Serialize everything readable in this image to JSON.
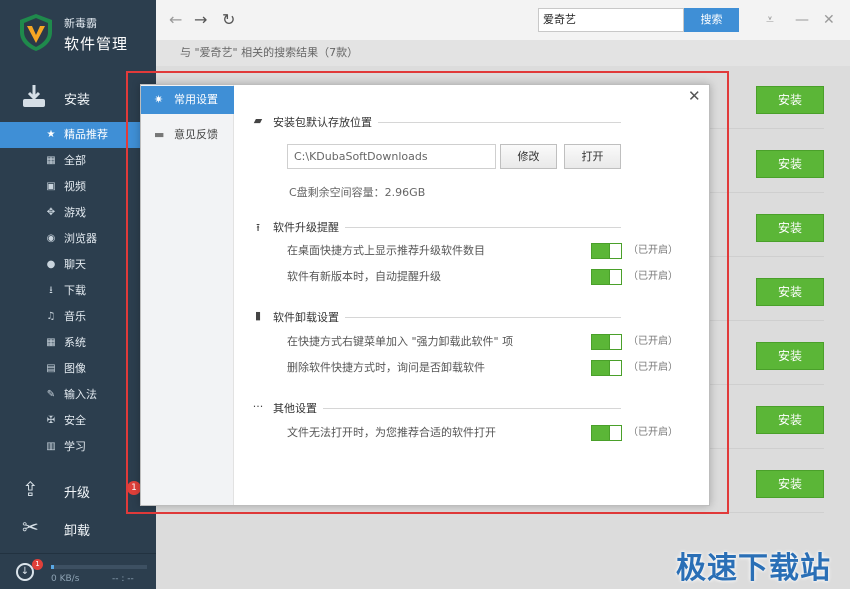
{
  "app": {
    "brand_small": "新毒霸",
    "brand_big": "软件管理"
  },
  "sidebar": {
    "install_label": "安装",
    "items": [
      {
        "label": "精品推荐",
        "icon": "star-icon",
        "glyph": "★",
        "active": true
      },
      {
        "label": "全部",
        "icon": "grid-icon",
        "glyph": "▦"
      },
      {
        "label": "视频",
        "icon": "video-icon",
        "glyph": "▣"
      },
      {
        "label": "游戏",
        "icon": "gamepad-icon",
        "glyph": "✥"
      },
      {
        "label": "浏览器",
        "icon": "globe-icon",
        "glyph": "◉"
      },
      {
        "label": "聊天",
        "icon": "chat-icon",
        "glyph": "●"
      },
      {
        "label": "下载",
        "icon": "download-icon",
        "glyph": "⭳"
      },
      {
        "label": "音乐",
        "icon": "music-icon",
        "glyph": "♫"
      },
      {
        "label": "系统",
        "icon": "windows-icon",
        "glyph": "▦"
      },
      {
        "label": "图像",
        "icon": "image-icon",
        "glyph": "▤"
      },
      {
        "label": "输入法",
        "icon": "pen-icon",
        "glyph": "✎"
      },
      {
        "label": "安全",
        "icon": "shield-icon",
        "glyph": "✠"
      },
      {
        "label": "学习",
        "icon": "book-icon",
        "glyph": "▥"
      }
    ],
    "upgrade_label": "升级",
    "upgrade_badge": "1",
    "uninstall_label": "卸载",
    "download_badge": "1",
    "download_speed": "0 KB/s",
    "download_eta": "-- : --",
    "download_progress": 0.03
  },
  "topbar": {
    "search_value": "爱奇艺",
    "search_button": "搜索"
  },
  "results": {
    "summary": "与 \"爱奇艺\" 相关的搜索结果（7款）",
    "install_label": "安装",
    "count": 7
  },
  "dialog": {
    "tabs": [
      {
        "label": "常用设置",
        "icon": "gear-icon",
        "glyph": "✷",
        "active": true
      },
      {
        "label": "意见反馈",
        "icon": "comment-icon",
        "glyph": "▬"
      }
    ],
    "sections": {
      "install_path": {
        "title": "安装包默认存放位置",
        "icon": "folder-icon"
      },
      "upgrade": {
        "title": "软件升级提醒",
        "icon": "upload-icon"
      },
      "uninstall": {
        "title": "软件卸载设置",
        "icon": "trash-icon"
      },
      "other": {
        "title": "其他设置",
        "icon": "more-icon"
      }
    },
    "path_value": "C:\\KDubaSoftDownloads",
    "modify_button": "修改",
    "open_button": "打开",
    "free_space": "C盘剩余空间容量：2.96GB",
    "options": [
      {
        "label": "在桌面快捷方式上显示推荐升级软件数目",
        "state": "（已开启）",
        "on": true
      },
      {
        "label": "软件有新版本时，自动提醒升级",
        "state": "（已开启）",
        "on": true
      },
      {
        "label": "在快捷方式右键菜单加入 \"强力卸载此软件\" 项",
        "state": "（已开启）",
        "on": true
      },
      {
        "label": "删除软件快捷方式时，询问是否卸载软件",
        "state": "（已开启）",
        "on": true
      },
      {
        "label": "文件无法打开时，为您推荐合适的软件打开",
        "state": "（已开启）",
        "on": true
      }
    ]
  },
  "watermark": "极速下载站",
  "colors": {
    "sidebar_bg": "#2c3e4e",
    "accent_blue": "#3f8fd6",
    "install_green": "#5bb637",
    "highlight_red": "#e13a3a"
  }
}
